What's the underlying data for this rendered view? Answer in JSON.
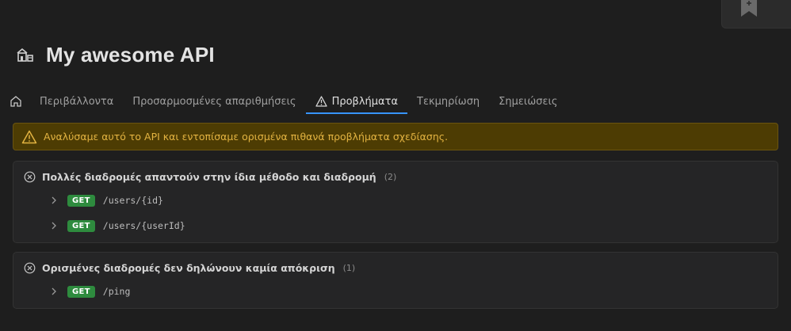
{
  "header": {
    "title": "My awesome API",
    "icon": "api-building-icon"
  },
  "tabs": [
    {
      "label": "",
      "icon": "home-icon",
      "active": false
    },
    {
      "label": "Περιβάλλοντα",
      "active": false
    },
    {
      "label": "Προσαρμοσμένες απαριθμήσεις",
      "active": false
    },
    {
      "label": "Προβλήματα",
      "icon": "warning-icon",
      "active": true
    },
    {
      "label": "Τεκμηρίωση",
      "active": false
    },
    {
      "label": "Σημειώσεις",
      "active": false
    }
  ],
  "banner": {
    "text": "Αναλύσαμε αυτό το API και εντοπίσαμε ορισμένα πιθανά προβλήματα σχεδίασης."
  },
  "issues": [
    {
      "title": "Πολλές διαδρομές απαντούν στην ίδια μέθοδο και διαδρομή",
      "count": "(2)",
      "routes": [
        {
          "method": "GET",
          "path": "/users/{id}"
        },
        {
          "method": "GET",
          "path": "/users/{userId}"
        }
      ]
    },
    {
      "title": "Ορισμένες διαδρομές δεν δηλώνουν καμία απόκριση",
      "count": "(1)",
      "routes": [
        {
          "method": "GET",
          "path": "/ping"
        }
      ]
    }
  ],
  "colors": {
    "background": "#1e1e1e",
    "accent": "#3794ff",
    "warning_bg": "#4d3c03",
    "warning_text": "#e3b341",
    "method_get": "#2e8b3e"
  }
}
